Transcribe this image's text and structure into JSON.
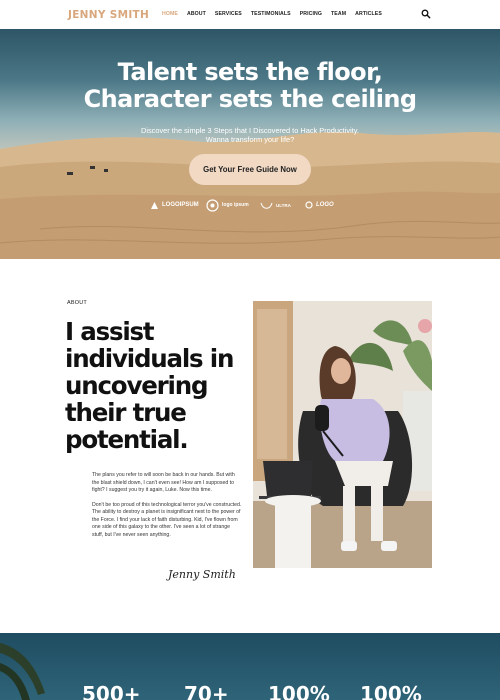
{
  "header": {
    "logo": "JENNY SMITH",
    "nav": [
      "HOME",
      "ABOUT",
      "SERVICES",
      "TESTIMONIALS",
      "PRICING",
      "TEAM",
      "ARTICLES"
    ],
    "active_nav": "HOME",
    "search_icon": "search-icon"
  },
  "hero": {
    "title_line1": "Talent sets the floor,",
    "title_line2": "Character sets the ceiling",
    "subtitle_line1": "Discover the simple 3 Steps that I Discovered to Hack Productivity.",
    "subtitle_line2": "Wanna transform your life?",
    "cta_label": "Get Your Free Guide Now",
    "logos": [
      "LOGOIPSUM",
      "logo ipsum",
      "ULTRA",
      "LOGO"
    ]
  },
  "about": {
    "label": "ABOUT",
    "heading_lines": [
      "I assist",
      "individuals in",
      "uncovering",
      "their true",
      "potential."
    ],
    "paragraph1": "The plans you refer to will soon be back in our hands. But with the blast shield down, I can't even see! How am I supposed to fight? I suggest you try it again, Luke. Now this time.",
    "paragraph2": "Don't be too proud of this technological terror you've constructed. The ability to destroy a planet is insignificant next to the power of the Force. I find your lack of faith disturbing. Kid, I've flown from one side of this galaxy to the other. I've seen a lot of strange stuff, but I've never seen anything.",
    "signature": "Jenny Smith"
  },
  "stats": [
    "500+",
    "70+",
    "100%",
    "100%"
  ],
  "colors": {
    "accent": "#d9a77d",
    "cta_bg": "#f1d9c4",
    "stats_bg": "#1f4c61"
  }
}
